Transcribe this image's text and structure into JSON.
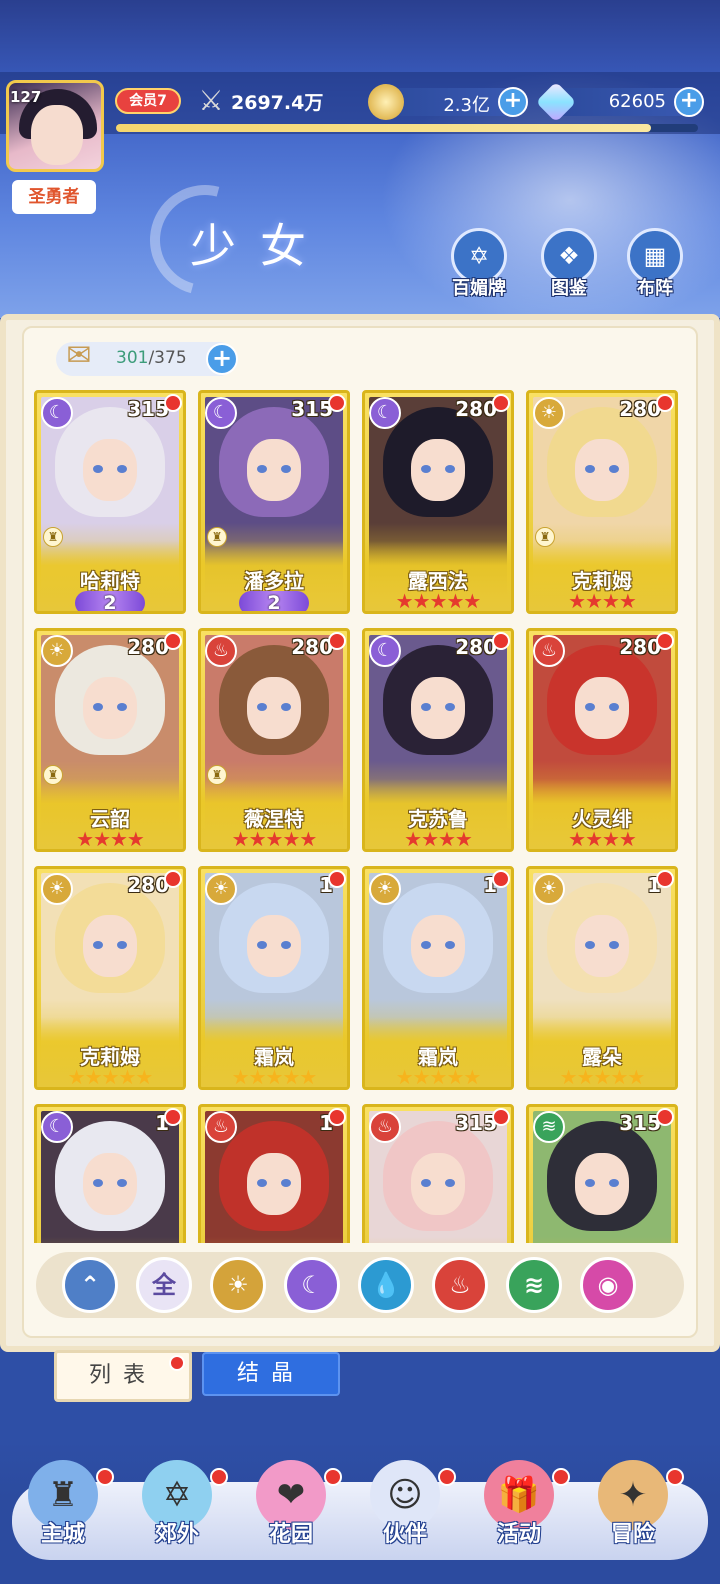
{
  "colors": {
    "accent": "#4a9de8",
    "badge": "#e8352e",
    "card_gold": "#e4c42a",
    "header_blue": "#3b5ec2"
  },
  "player": {
    "level": "127",
    "title": "圣勇者",
    "vip": "会员7",
    "power": "2697.4万",
    "exp_progress": 0.92
  },
  "resources": {
    "gold": "2.3亿",
    "gems": "62605",
    "plus": "+"
  },
  "header": {
    "title": "少女",
    "buttons": [
      {
        "label": "百媚牌",
        "icon": "card-icon"
      },
      {
        "label": "图鉴",
        "icon": "book-icon"
      },
      {
        "label": "布阵",
        "icon": "formation-grid-icon"
      }
    ]
  },
  "capacity": {
    "current": "301",
    "max": "/375"
  },
  "cards": [
    {
      "name": "哈莉特",
      "level": "315",
      "element": "moon",
      "rank": "2",
      "stars": 0,
      "star_type": "none"
    },
    {
      "name": "潘多拉",
      "level": "315",
      "element": "moon",
      "rank": "2",
      "stars": 0,
      "star_type": "none"
    },
    {
      "name": "露西法",
      "level": "280",
      "element": "moon",
      "rank": "",
      "stars": 5,
      "star_type": "red"
    },
    {
      "name": "克莉姆",
      "level": "280",
      "element": "sun",
      "rank": "",
      "stars": 4,
      "star_type": "red"
    },
    {
      "name": "云韶",
      "level": "280",
      "element": "sun",
      "rank": "",
      "stars": 4,
      "star_type": "red"
    },
    {
      "name": "薇涅特",
      "level": "280",
      "element": "fire",
      "rank": "",
      "stars": 5,
      "star_type": "red"
    },
    {
      "name": "克苏鲁",
      "level": "280",
      "element": "moon",
      "rank": "",
      "stars": 4,
      "star_type": "red"
    },
    {
      "name": "火灵绯",
      "level": "280",
      "element": "fire",
      "rank": "",
      "stars": 4,
      "star_type": "red"
    },
    {
      "name": "克莉姆",
      "level": "280",
      "element": "sun",
      "rank": "",
      "stars": 5,
      "star_type": "gold"
    },
    {
      "name": "霜岚",
      "level": "1",
      "element": "sun",
      "rank": "",
      "stars": 5,
      "star_type": "gold"
    },
    {
      "name": "霜岚",
      "level": "1",
      "element": "sun",
      "rank": "",
      "stars": 5,
      "star_type": "gold"
    },
    {
      "name": "露朵",
      "level": "1",
      "element": "sun",
      "rank": "",
      "stars": 5,
      "star_type": "gold"
    },
    {
      "name": "",
      "level": "1",
      "element": "moon",
      "rank": "",
      "stars": 0,
      "star_type": "none"
    },
    {
      "name": "",
      "level": "1",
      "element": "fire",
      "rank": "",
      "stars": 0,
      "star_type": "none"
    },
    {
      "name": "",
      "level": "315",
      "element": "fire",
      "rank": "",
      "stars": 0,
      "star_type": "none"
    },
    {
      "name": "",
      "level": "315",
      "element": "wind",
      "rank": "",
      "stars": 0,
      "star_type": "none"
    }
  ],
  "filters": [
    {
      "id": "collapse",
      "label": "",
      "icon": "up-chevron-icon"
    },
    {
      "id": "all",
      "label": "全",
      "icon": "all-icon"
    },
    {
      "id": "sun",
      "label": "",
      "icon": "sun-icon"
    },
    {
      "id": "moon",
      "label": "",
      "icon": "moon-icon"
    },
    {
      "id": "water",
      "label": "",
      "icon": "water-drop-icon"
    },
    {
      "id": "fire",
      "label": "",
      "icon": "fire-icon"
    },
    {
      "id": "wind",
      "label": "",
      "icon": "wind-icon"
    },
    {
      "id": "star",
      "label": "",
      "icon": "planet-icon"
    }
  ],
  "tabs": {
    "list": "列表",
    "crystal": "结晶"
  },
  "nav": [
    {
      "label": "主城",
      "icon": "castle-icon"
    },
    {
      "label": "郊外",
      "icon": "portal-icon"
    },
    {
      "label": "花园",
      "icon": "heart-icon"
    },
    {
      "label": "伙伴",
      "icon": "companion-icon"
    },
    {
      "label": "活动",
      "icon": "gift-icon"
    },
    {
      "label": "冒险",
      "icon": "compass-icon"
    }
  ]
}
